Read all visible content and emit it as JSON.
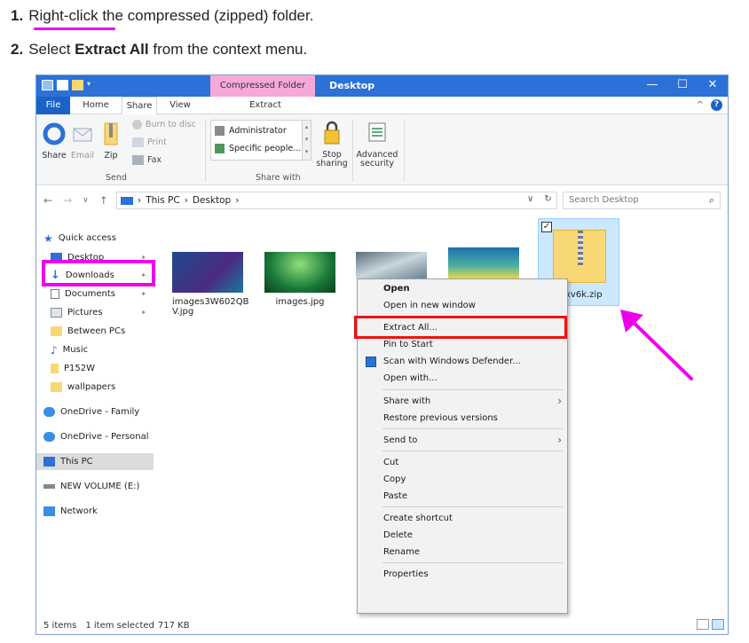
{
  "instructions": {
    "step1_num": "1.",
    "step1_link": "Right-click",
    "step1_rest": " the compressed (zipped) folder.",
    "step2_num": "2.",
    "step2_pre": "Select ",
    "step2_bold": "Extract All",
    "step2_post": " from the context menu."
  },
  "window": {
    "context_tab": "Compressed Folder Tools",
    "title": "Desktop",
    "controls": {
      "minimize": "—",
      "maximize": "☐",
      "close": "✕"
    }
  },
  "ribbon_tabs": {
    "file": "File",
    "home": "Home",
    "share": "Share",
    "view": "View",
    "extract": "Extract"
  },
  "ribbon": {
    "share": "Share",
    "email": "Email",
    "zip": "Zip",
    "burn": "Burn to disc",
    "print": "Print",
    "fax": "Fax",
    "send_group": "Send",
    "share_list_1": "Administrator",
    "share_list_2": "Specific people...",
    "stop_sharing_1": "Stop",
    "stop_sharing_2": "sharing",
    "share_with_group": "Share with",
    "advanced_1": "Advanced",
    "advanced_2": "security"
  },
  "address": {
    "this_pc": "This PC",
    "desktop": "Desktop",
    "search_placeholder": "Search Desktop"
  },
  "nav": {
    "quick_access": "Quick access",
    "desktop": "Desktop",
    "downloads": "Downloads",
    "documents": "Documents",
    "pictures": "Pictures",
    "between_pcs": "Between PCs",
    "music": "Music",
    "p152w": "P152W",
    "wallpapers": "wallpapers",
    "onedrive_family": "OneDrive - Family",
    "onedrive_personal": "OneDrive - Personal",
    "this_pc": "This PC",
    "new_volume": "NEW VOLUME (E:)",
    "network": "Network"
  },
  "files": {
    "file1_line1": "images3W602QB",
    "file1_line2": "V.jpg",
    "file2": "images.jpg",
    "zip_partial": "xv6k.zip"
  },
  "context_menu": {
    "open": "Open",
    "open_new_window": "Open in new window",
    "extract_all": "Extract All...",
    "pin_to_start": "Pin to Start",
    "scan_defender": "Scan with Windows Defender...",
    "open_with": "Open with...",
    "share_with": "Share with",
    "restore_prev": "Restore previous versions",
    "send_to": "Send to",
    "cut": "Cut",
    "copy": "Copy",
    "paste": "Paste",
    "create_shortcut": "Create shortcut",
    "delete": "Delete",
    "rename": "Rename",
    "properties": "Properties"
  },
  "status": {
    "items": "5 items",
    "selected": "1 item selected",
    "size": "717 KB"
  },
  "colors": {
    "highlight_magenta": "#ee00ee",
    "highlight_red": "#ee1111",
    "titlebar_blue": "#2b71d8",
    "context_tab_pink": "#f6a8d8",
    "selection_blue": "#cce8ff"
  }
}
